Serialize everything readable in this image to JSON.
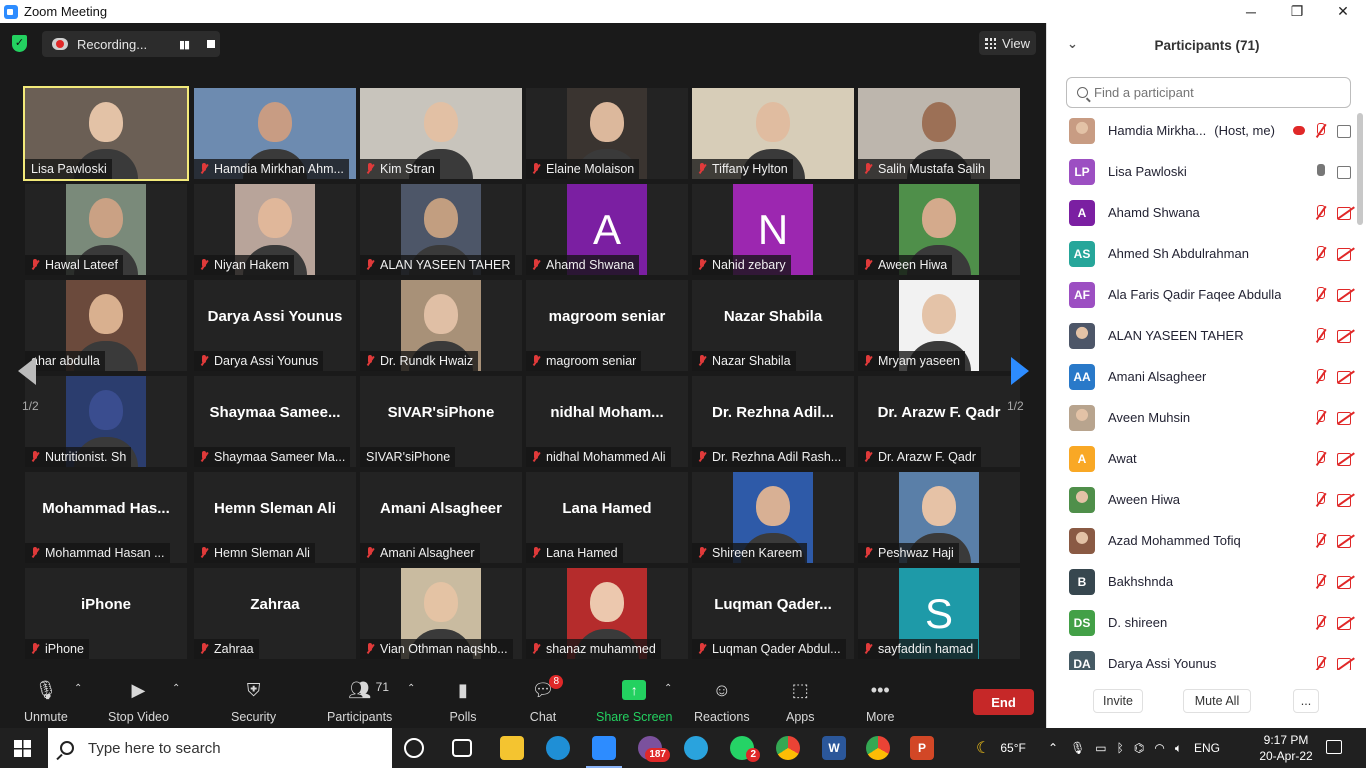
{
  "window": {
    "title": "Zoom Meeting",
    "minimize": "─",
    "restore": "❐",
    "close": "✕"
  },
  "topbar": {
    "recording_label": "Recording...",
    "pause_icon": "▮▮",
    "view_label": "View"
  },
  "colors": {
    "accent": "#2d8cff",
    "muted": "#e03a3a",
    "green": "#23d160",
    "active_speaker": "#f3ea7a",
    "end": "#c62828"
  },
  "tiles": [
    {
      "name": "Lisa Pawloski",
      "kind": "photo",
      "bg": "#6b5f55",
      "skin": "#e3c2a6",
      "active": true,
      "muted": false
    },
    {
      "name": "Hamdia Mirkhan Ahm...",
      "kind": "photo",
      "bg": "#6d8bb0",
      "skin": "#c89c83",
      "muted": true
    },
    {
      "name": "Kim Stran",
      "kind": "photo",
      "bg": "#c8c4bc",
      "skin": "#e2c0a4",
      "muted": true
    },
    {
      "name": "Elaine Molaison",
      "kind": "photo",
      "bg": "#3a3430",
      "skin": "#dcb89c",
      "muted": true
    },
    {
      "name": "Tiffany Hylton",
      "kind": "photo",
      "bg": "#d7cdb8",
      "skin": "#e0bca0",
      "muted": true
    },
    {
      "name": "Salih Mustafa Salih",
      "kind": "photo",
      "bg": "#bdb6ad",
      "skin": "#9c7056",
      "muted": true
    },
    {
      "name": "Hawal Lateef",
      "kind": "photo",
      "bg": "#7a8a7a",
      "skin": "#caa184",
      "muted": true
    },
    {
      "name": "Niyan Hakem",
      "kind": "photo",
      "bg": "#b8a49a",
      "skin": "#e0b79a",
      "muted": true
    },
    {
      "name": "ALAN YASEEN TAHER",
      "kind": "photo",
      "bg": "#4d5668",
      "skin": "#c29e80",
      "muted": true
    },
    {
      "name": "Ahamd Shwana",
      "kind": "letter",
      "letter": "A",
      "bg": "#7b1fa2",
      "muted": true
    },
    {
      "name": "Nahid zebary",
      "kind": "letter",
      "letter": "N",
      "bg": "#9c27b0",
      "muted": true
    },
    {
      "name": "Aween Hiwa",
      "kind": "photo",
      "bg": "#4f8f4a",
      "skin": "#d4aa8c",
      "muted": true
    },
    {
      "name": "ahar abdulla",
      "kind": "photo",
      "bg": "#6b4a3c",
      "skin": "#d9b08f",
      "muted": false,
      "nomic": true
    },
    {
      "name": "Darya Assi Younus",
      "big": "Darya Assi Younus",
      "kind": "text",
      "muted": true
    },
    {
      "name": "Dr. Rundk Hwaiz",
      "kind": "photo",
      "bg": "#a89178",
      "skin": "#e0bfa5",
      "muted": true
    },
    {
      "name": "magroom seniar",
      "big": "magroom seniar",
      "kind": "text",
      "muted": true
    },
    {
      "name": "Nazar Shabila",
      "big": "Nazar Shabila",
      "kind": "text",
      "muted": true
    },
    {
      "name": "Mryam yaseen",
      "kind": "photo",
      "bg": "#f2f2f2",
      "skin": "#e4c3a8",
      "muted": true
    },
    {
      "name": "Nutritionist. Sh",
      "kind": "photo",
      "bg": "#2b3d6e",
      "skin": "#3a4d8f",
      "muted": true
    },
    {
      "name": "Shaymaa Sameer Ma...",
      "big": "Shaymaa Samee...",
      "kind": "text",
      "muted": true
    },
    {
      "name": "SIVAR'siPhone",
      "big": "SIVAR'siPhone",
      "kind": "text",
      "muted": false
    },
    {
      "name": "nidhal Mohammed Ali",
      "big": "nidhal Moham...",
      "kind": "text",
      "muted": true
    },
    {
      "name": "Dr. Rezhna Adil Rash...",
      "big": "Dr. Rezhna Adil...",
      "kind": "text",
      "muted": true
    },
    {
      "name": "Dr. Arazw F. Qadr",
      "big": "Dr. Arazw F. Qadr",
      "kind": "text",
      "muted": true
    },
    {
      "name": "Mohammad Hasan ...",
      "big": "Mohammad Has...",
      "kind": "text",
      "muted": true
    },
    {
      "name": "Hemn Sleman Ali",
      "big": "Hemn Sleman Ali",
      "kind": "text",
      "muted": true
    },
    {
      "name": "Amani Alsagheer",
      "big": "Amani Alsagheer",
      "kind": "text",
      "muted": true
    },
    {
      "name": "Lana Hamed",
      "big": "Lana Hamed",
      "kind": "text",
      "muted": true
    },
    {
      "name": "Shireen Kareem",
      "kind": "photo",
      "bg": "#2e5aa8",
      "skin": "#d8b094",
      "muted": true
    },
    {
      "name": "Peshwaz Haji",
      "kind": "photo",
      "bg": "#5a7fa8",
      "skin": "#e6c2a6",
      "muted": true
    },
    {
      "name": "iPhone",
      "big": "iPhone",
      "kind": "text",
      "muted": true
    },
    {
      "name": "Zahraa",
      "big": "Zahraa",
      "kind": "text",
      "muted": true
    },
    {
      "name": "Vian Othman naqshb...",
      "kind": "photo",
      "bg": "#c9bba0",
      "skin": "#e4c3a4",
      "muted": true
    },
    {
      "name": "shanaz muhammed",
      "kind": "photo",
      "bg": "#b52c2c",
      "skin": "#ecc8ae",
      "muted": true
    },
    {
      "name": "Luqman Qader Abdul...",
      "big": "Luqman Qader...",
      "kind": "text",
      "muted": true
    },
    {
      "name": "sayfaddin hamad",
      "kind": "letter",
      "letter": "S",
      "bg": "#1e9aa8",
      "muted": true
    }
  ],
  "pager": {
    "left": "1/2",
    "right": "1/2"
  },
  "toolbar": {
    "unmute": "Unmute",
    "stop_video": "Stop Video",
    "security": "Security",
    "participants": "Participants",
    "participants_count": "71",
    "polls": "Polls",
    "chat": "Chat",
    "chat_badge": "8",
    "share_screen": "Share Screen",
    "reactions": "Reactions",
    "apps": "Apps",
    "more": "More",
    "end": "End"
  },
  "panel": {
    "title": "Participants (71)",
    "search_placeholder": "Find a participant",
    "participants": [
      {
        "name": "Hamdia Mirkha...",
        "tag": "(Host, me)",
        "avatar": "photo",
        "color": "#c89c83",
        "mic": "off",
        "cam": "on",
        "rec": true
      },
      {
        "name": "Lisa Pawloski",
        "avatar": "LP",
        "color": "#9c4fc2",
        "mic": "on",
        "cam": "on"
      },
      {
        "name": "Ahamd Shwana",
        "avatar": "A",
        "color": "#7b1fa2",
        "mic": "off",
        "cam": "off"
      },
      {
        "name": "Ahmed Sh Abdulrahman",
        "avatar": "AS",
        "color": "#26a69a",
        "mic": "off",
        "cam": "off"
      },
      {
        "name": "Ala Faris Qadir Faqee Abdulla",
        "avatar": "AF",
        "color": "#9c4fc2",
        "mic": "off",
        "cam": "off"
      },
      {
        "name": "ALAN YASEEN TAHER",
        "avatar": "photo",
        "color": "#4d5668",
        "mic": "off",
        "cam": "off"
      },
      {
        "name": "Amani Alsagheer",
        "avatar": "AA",
        "color": "#2979c9",
        "mic": "off",
        "cam": "off"
      },
      {
        "name": "Aveen Muhsin",
        "avatar": "photo",
        "color": "#b8a48e",
        "mic": "off",
        "cam": "off"
      },
      {
        "name": "Awat",
        "avatar": "A",
        "color": "#f9a825",
        "mic": "off",
        "cam": "off"
      },
      {
        "name": "Aween Hiwa",
        "avatar": "photo",
        "color": "#4f8f4a",
        "mic": "off",
        "cam": "off"
      },
      {
        "name": "Azad Mohammed Tofiq",
        "avatar": "photo",
        "color": "#8a5a44",
        "mic": "off",
        "cam": "off"
      },
      {
        "name": "Bakhshnda",
        "avatar": "B",
        "color": "#37474f",
        "mic": "off",
        "cam": "off"
      },
      {
        "name": "D. shireen",
        "avatar": "DS",
        "color": "#43a047",
        "mic": "off",
        "cam": "off"
      },
      {
        "name": "Darya Assi Younus",
        "avatar": "DA",
        "color": "#455a64",
        "mic": "off",
        "cam": "off"
      }
    ],
    "invite": "Invite",
    "mute_all": "Mute All",
    "more": "..."
  },
  "taskbar": {
    "search_placeholder": "Type here to search",
    "weather": "65°F",
    "language": "ENG",
    "time": "9:17 PM",
    "date": "20-Apr-22",
    "viber_badge": "187",
    "whatsapp_badge": "2"
  }
}
